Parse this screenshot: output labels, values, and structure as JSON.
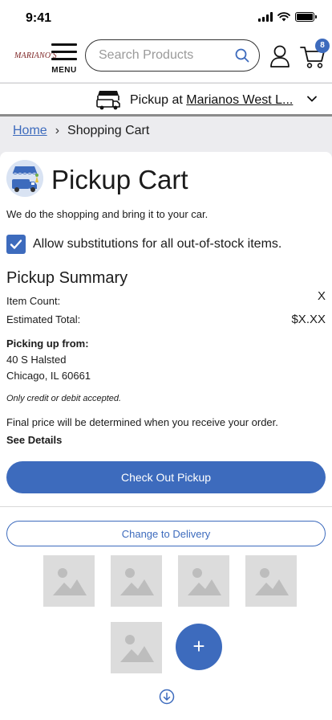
{
  "status_bar": {
    "time": "9:41"
  },
  "header": {
    "logo_text": "MARIANO'S",
    "menu_label": "MENU",
    "search_placeholder": "Search Products",
    "cart_count": "8"
  },
  "store_bar": {
    "prefix": "Pickup at ",
    "store_name": "Marianos West L..."
  },
  "breadcrumb": {
    "home": "Home",
    "separator": "›",
    "current": "Shopping Cart"
  },
  "cart": {
    "title": "Pickup Cart",
    "tagline": "We do the shopping and bring it to your car.",
    "substitutions_label": "Allow substitutions for all out-of-stock items.",
    "substitutions_checked": true,
    "summary_title": "Pickup Summary",
    "item_count_label": "Item Count:",
    "item_count_value": "X",
    "estimated_total_label": "Estimated Total:",
    "estimated_total_value": "$X.XX",
    "pickup_from_label": "Picking up from:",
    "address_line1": "40 S Halsted",
    "address_line2": "Chicago, IL 60661",
    "payment_note": "Only credit or debit accepted.",
    "final_price_note": "Final price will be determined when you receive your order.",
    "see_details": "See Details",
    "checkout_label": "Check Out Pickup",
    "delivery_label": "Change to Delivery",
    "add_label": "+"
  },
  "colors": {
    "accent": "#3d6bbd",
    "text": "#1b1b1b",
    "logo": "#7a1f1f"
  },
  "icons": [
    "menu-icon",
    "search-icon",
    "account-icon",
    "cart-icon",
    "pickup-truck-icon",
    "chevron-down-icon",
    "checkmark-icon",
    "image-placeholder-icon",
    "plus-icon",
    "scroll-down-icon"
  ]
}
